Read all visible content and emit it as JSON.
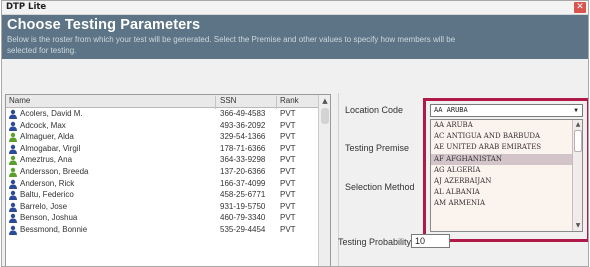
{
  "window": {
    "title": "DTP Lite",
    "close_glyph": "✕"
  },
  "header": {
    "heading": "Choose Testing Parameters",
    "description": "Below is the roster from which your test will be generated.  Select the Premise and other values to specify how members will be selected for testing."
  },
  "table": {
    "columns": [
      "Name",
      "SSN",
      "Rank"
    ],
    "rows": [
      {
        "name": "Acolers, David M.",
        "ssn": "366-49-4583",
        "rank": "PVT",
        "icon_color": "#2b4b9a"
      },
      {
        "name": "Adcock, Max",
        "ssn": "493-36-2092",
        "rank": "PVT",
        "icon_color": "#2b4b9a"
      },
      {
        "name": "Almaguer, Alda",
        "ssn": "329-54-1366",
        "rank": "PVT",
        "icon_color": "#5aa02c"
      },
      {
        "name": "Almogabar, Virgil",
        "ssn": "178-71-6366",
        "rank": "PVT",
        "icon_color": "#2b4b9a"
      },
      {
        "name": "Ameztrus, Ana",
        "ssn": "364-33-9298",
        "rank": "PVT",
        "icon_color": "#5aa02c"
      },
      {
        "name": "Andersson, Breeda",
        "ssn": "137-20-6366",
        "rank": "PVT",
        "icon_color": "#5aa02c"
      },
      {
        "name": "Anderson, Rick",
        "ssn": "166-37-4099",
        "rank": "PVT",
        "icon_color": "#2b4b9a"
      },
      {
        "name": "Baltu, Federico",
        "ssn": "458-25-6771",
        "rank": "PVT",
        "icon_color": "#2b4b9a"
      },
      {
        "name": "Barrelo, Jose",
        "ssn": "931-19-5750",
        "rank": "PVT",
        "icon_color": "#2b4b9a"
      },
      {
        "name": "Benson, Joshua",
        "ssn": "460-79-3340",
        "rank": "PVT",
        "icon_color": "#2b4b9a"
      },
      {
        "name": "Bessmond, Bonnie",
        "ssn": "535-29-4454",
        "rank": "PVT",
        "icon_color": "#2b4b9a"
      }
    ],
    "scroll_up_glyph": "▲"
  },
  "form": {
    "location_code_label": "Location Code",
    "testing_premise_label": "Testing Premise",
    "selection_method_label": "Selection Method",
    "testing_probability_label": "Testing Probability",
    "testing_probability_value": "10"
  },
  "location_select": {
    "selected": "AA ARUBA",
    "dropdown_glyph": "▼",
    "options": [
      {
        "label": "AA ARUBA",
        "selected": false
      },
      {
        "label": "AC ANTIGUA AND BARBUDA",
        "selected": false
      },
      {
        "label": "AE UNITED ARAB EMIRATES",
        "selected": false
      },
      {
        "label": "AF AFGHANISTAN",
        "selected": true
      },
      {
        "label": "AG ALGERIA",
        "selected": false
      },
      {
        "label": "AJ AZERBAIJAN",
        "selected": false
      },
      {
        "label": "AL ALBANIA",
        "selected": false
      },
      {
        "label": "AM ARMENIA",
        "selected": false
      }
    ],
    "scroll_up_glyph": "▲",
    "scroll_down_glyph": "▼"
  },
  "colors": {
    "header_bg": "#5c7485",
    "highlight_border": "#b01948",
    "list_bg": "#fbf3ee",
    "selected_option_bg": "#d3c4c9"
  },
  "icons": {
    "member_icon": "person-icon"
  }
}
